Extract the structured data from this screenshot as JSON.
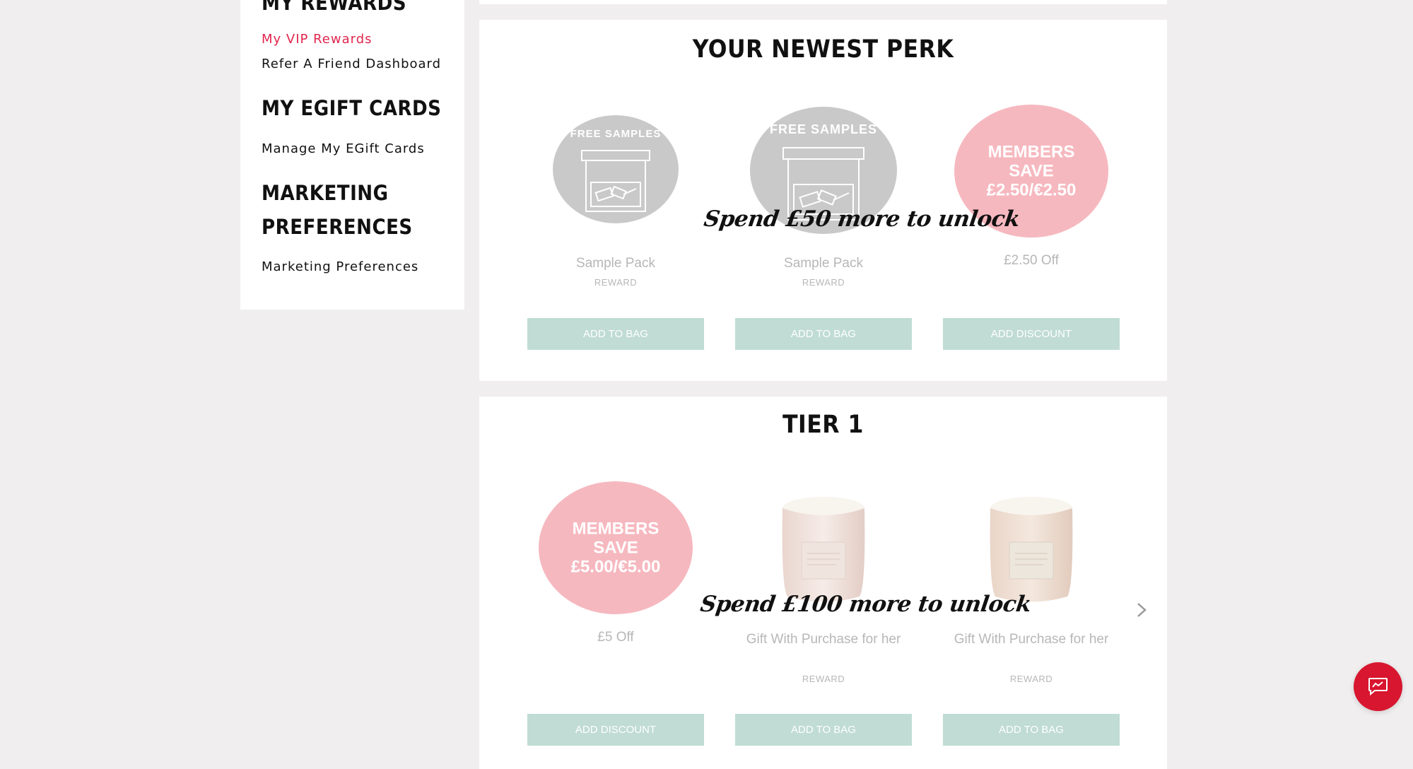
{
  "sidebar": {
    "sections": [
      {
        "heading": "My Rewards",
        "links": [
          "My VIP Rewards",
          "Refer A Friend Dashboard"
        ]
      },
      {
        "heading": "My eGift Cards",
        "links": [
          "Manage My EGift Cards"
        ]
      },
      {
        "heading": "Marketing Preferences",
        "links": [
          "Marketing Preferences"
        ]
      }
    ],
    "active_link": "My VIP Rewards",
    "active_color": "#e0264e"
  },
  "newest_perk": {
    "title": "YOUR NEWEST PERK",
    "unlock_message": "Spend £50 more to unlock",
    "cards": [
      {
        "icon": "free-samples-box-icon",
        "circle_label": "FREE SAMPLES",
        "name": "Sample Pack",
        "sub": "REWARD",
        "button": "ADD TO BAG"
      },
      {
        "icon": "free-samples-box-icon",
        "circle_label": "FREE SAMPLES",
        "name": "Sample Pack",
        "sub": "REWARD",
        "button": "ADD TO BAG"
      },
      {
        "circle_label": "MEMBERS SAVE £2.50/€2.50",
        "name": "£2.50 Off",
        "button": "ADD DISCOUNT"
      }
    ]
  },
  "tier1": {
    "title": "TIER 1",
    "unlock_message": "Spend £100 more to unlock",
    "cards": [
      {
        "circle_label": "MEMBERS SAVE £5.00/€5.00",
        "name": "£5 Off",
        "button": "ADD DISCOUNT"
      },
      {
        "icon": "candle-icon",
        "name": "Gift With Purchase for her",
        "sub": "REWARD",
        "button": "ADD TO BAG"
      },
      {
        "icon": "candle-icon",
        "name": "Gift With Purchase for her",
        "sub": "REWARD",
        "button": "ADD TO BAG"
      }
    ],
    "next_icon": "chevron-right-icon"
  },
  "chat_widget": {
    "icon": "chat-bubble-icon",
    "color": "#d8162f"
  },
  "colors": {
    "button_bg": "#c0dcd4",
    "pink_circle": "#f6b8bf",
    "grey_circle": "#c9c9c9",
    "page_bg": "#f0eeef"
  }
}
